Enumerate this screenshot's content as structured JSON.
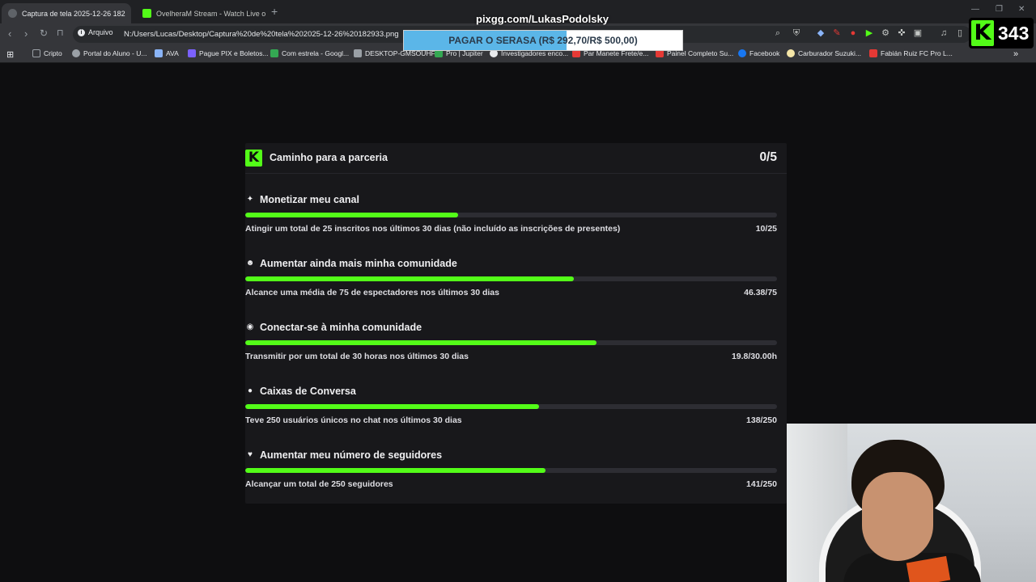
{
  "browser": {
    "tabs": [
      {
        "title": "Captura de tela 2025-12-26 182",
        "active": true
      },
      {
        "title": "OvelheraM Stream - Watch Live on K",
        "active": false
      }
    ],
    "new_tab_symbol": "+",
    "address": {
      "security_label": "Arquivo",
      "url": "N:/Users/Lucas/Desktop/Captura%20de%20tela%202025-12-26%20182933.png"
    },
    "bookmarks": [
      {
        "label": "Cripto",
        "icon": "folder-icon",
        "color": "#9aa0a6"
      },
      {
        "label": "Portal do Aluno - U...",
        "icon": "globe-icon",
        "color": "#9aa0a6"
      },
      {
        "label": "AVA",
        "icon": "ava-icon",
        "color": "#8ab4f8"
      },
      {
        "label": "Pague PIX e Boletos...",
        "icon": "pay-icon",
        "color": "#7b61ff"
      },
      {
        "label": "Com estrela - Googl...",
        "icon": "drive-icon",
        "color": "#34a853"
      },
      {
        "label": "DESKTOP-GMSOUHF",
        "icon": "desktop-icon",
        "color": "#9aa0a6"
      },
      {
        "label": "Pro | Jupiter",
        "icon": "jupiter-icon",
        "color": "#34a853"
      },
      {
        "label": "Investigadores enco...",
        "icon": "google-icon",
        "color": "#e8eaed"
      },
      {
        "label": "Par Manete Frete/e...",
        "icon": "ml-icon",
        "color": "#e53935"
      },
      {
        "label": "Painel Completo Su...",
        "icon": "panel-icon",
        "color": "#e53935"
      },
      {
        "label": "Facebook",
        "icon": "facebook-icon",
        "color": "#1877f2"
      },
      {
        "label": "Carburador Suzuki...",
        "icon": "store-icon",
        "color": "#f5e6a8"
      },
      {
        "label": "Fabián Ruiz FC Pro L...",
        "icon": "fifa-icon",
        "color": "#e53935"
      }
    ],
    "bookmarks_more": "»"
  },
  "overlay": {
    "pix_url": "pixgg.com/LukasPodolsky",
    "goal_text": "PAGAR O SERASA (R$ 292,70/R$ 500,00)",
    "goal_progress": 0.5854,
    "viewer_count": "343"
  },
  "partnership": {
    "title": "Caminho para a parceria",
    "logo": "K",
    "count": "0/5",
    "goals": [
      {
        "icon": "sparkle-icon",
        "glyph": "✦",
        "title": "Monetizar meu canal",
        "description": "Atingir um total de 25 inscritos nos últimos 30 dias (não incluído as inscrições de presentes)",
        "value": "10/25",
        "progress": 0.4
      },
      {
        "icon": "community-icon",
        "glyph": "☻",
        "title": "Aumentar ainda mais minha comunidade",
        "description": "Alcance uma média de 75 de espectadores nos últimos 30 dias",
        "value": "46.38/75",
        "progress": 0.6184
      },
      {
        "icon": "broadcast-icon",
        "glyph": "◉",
        "title": "Conectar-se à minha comunidade",
        "description": "Transmitir por um total de 30 horas nos últimos 30 dias",
        "value": "19.8/30.00h",
        "progress": 0.66
      },
      {
        "icon": "chat-icon",
        "glyph": "●",
        "title": "Caixas de Conversa",
        "description": "Teve 250 usuários únicos no chat nos últimos 30 dias",
        "value": "138/250",
        "progress": 0.552
      },
      {
        "icon": "heart-icon",
        "glyph": "♥",
        "title": "Aumentar meu número de seguidores",
        "description": "Alcançar um total de 250 seguidores",
        "value": "141/250",
        "progress": 0.564
      }
    ]
  },
  "colors": {
    "accent": "#53fc18",
    "card_bg": "#18181b",
    "page_bg": "#0e0e10",
    "goal_bar": "#5bb6e8"
  }
}
